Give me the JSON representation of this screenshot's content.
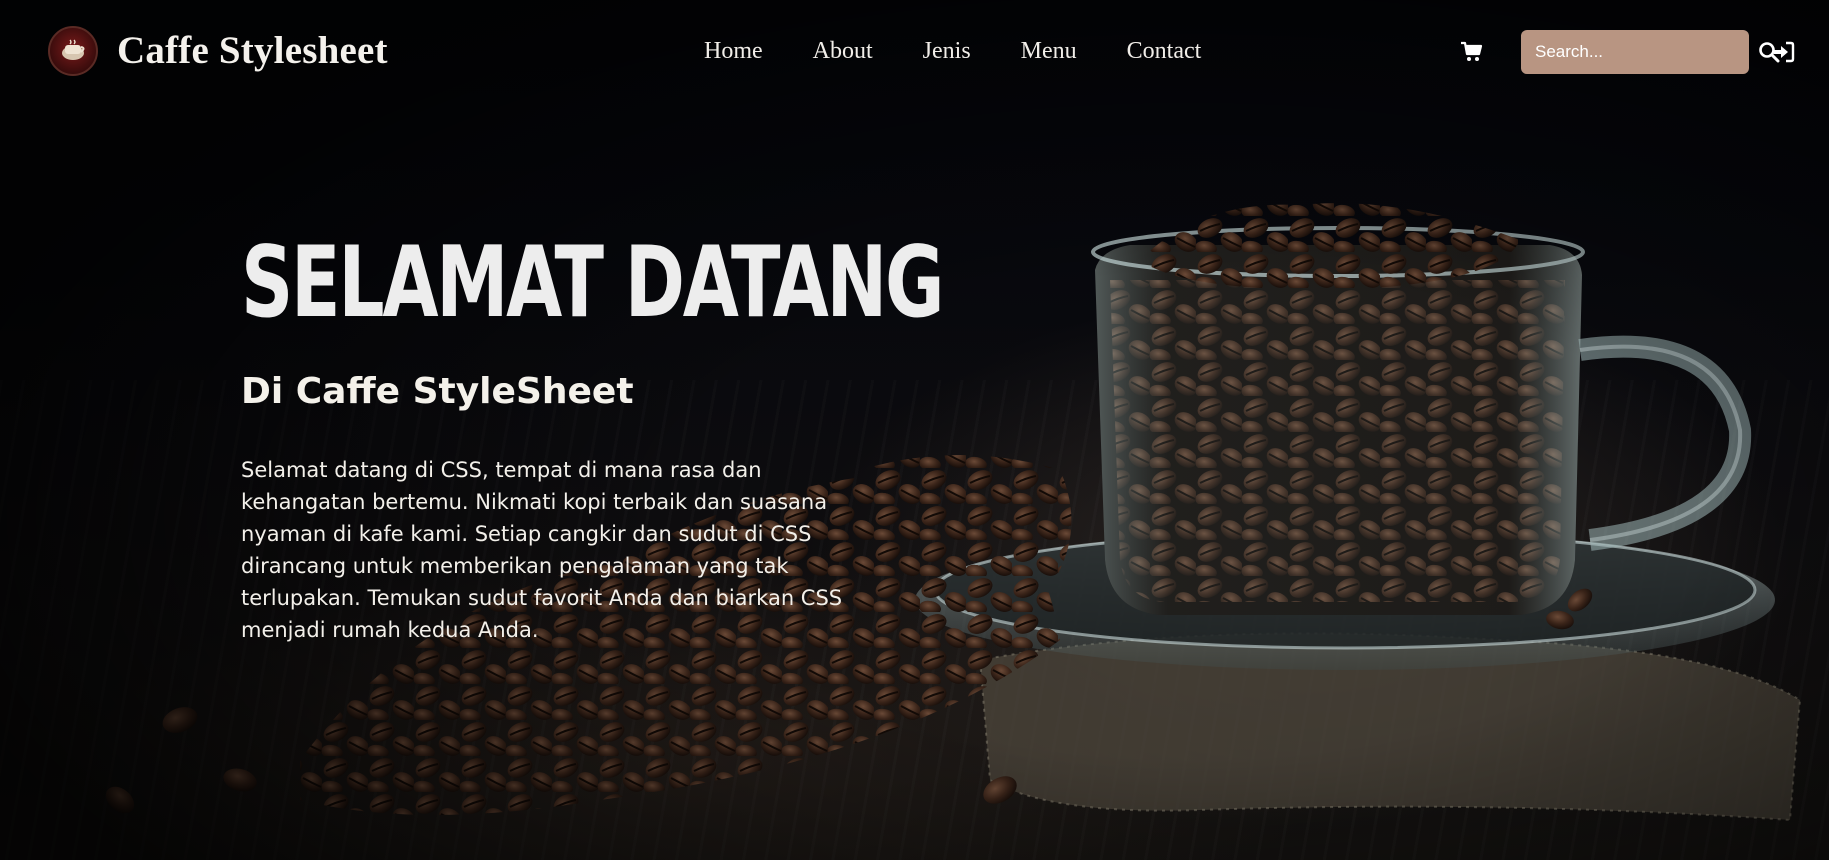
{
  "navbar": {
    "brand_title": "Caffe Stylesheet",
    "links": [
      "Home",
      "About",
      "Jenis",
      "Menu",
      "Contact"
    ],
    "search": {
      "placeholder": "Search..."
    }
  },
  "hero": {
    "heading": "SELAMAT DATANG",
    "subheading": "Di Caffe StyleSheet",
    "paragraph": "Selamat datang di CSS, tempat di mana rasa dan kehangatan bertemu. Nikmati kopi terbaik dan suasana nyaman di kafe kami. Setiap cangkir dan sudut di CSS dirancang untuk memberikan pengalaman yang tak terlupakan. Temukan sudut favorit Anda dan biarkan CSS menjadi rumah kedua Anda."
  },
  "icons": {
    "logo": "coffee-logo-icon",
    "cart": "cart-icon",
    "search": "search-icon",
    "login": "sign-in-icon"
  },
  "colors": {
    "search_background": "#b89582",
    "text": "#f3f0ea",
    "background": "#05060a"
  }
}
